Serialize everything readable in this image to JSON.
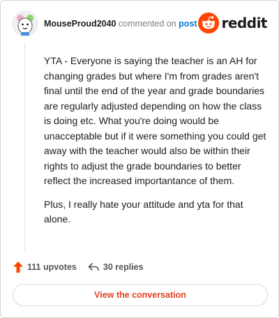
{
  "comment": {
    "username": "MouseProud2040",
    "action_text": "commented on",
    "post_link": "post",
    "paragraphs": [
      "YTA - Everyone is saying the teacher is an AH for changing grades but where I'm from grades aren't final until the end of the year and grade boundaries are regularly adjusted depending on how the class is doing etc. What you're doing would be unacceptable but if it were something you could get away with the teacher would also be within their rights to adjust the grade boundaries to better reflect the increased importantance of them.",
      "Plus, I really hate your attitude and yta for that alone."
    ]
  },
  "brand": {
    "name": "reddit",
    "icon": "reddit-logo-icon",
    "color": "#ff4500"
  },
  "stats": {
    "upvotes": "111 upvotes",
    "replies": "30 replies",
    "upvote_icon": "upvote-arrow-icon",
    "reply_icon": "reply-arrow-icon"
  },
  "cta": {
    "label": "View the conversation"
  },
  "colors": {
    "accent": "#ff4500",
    "link": "#0079d3",
    "cta_text": "#e0431f"
  }
}
